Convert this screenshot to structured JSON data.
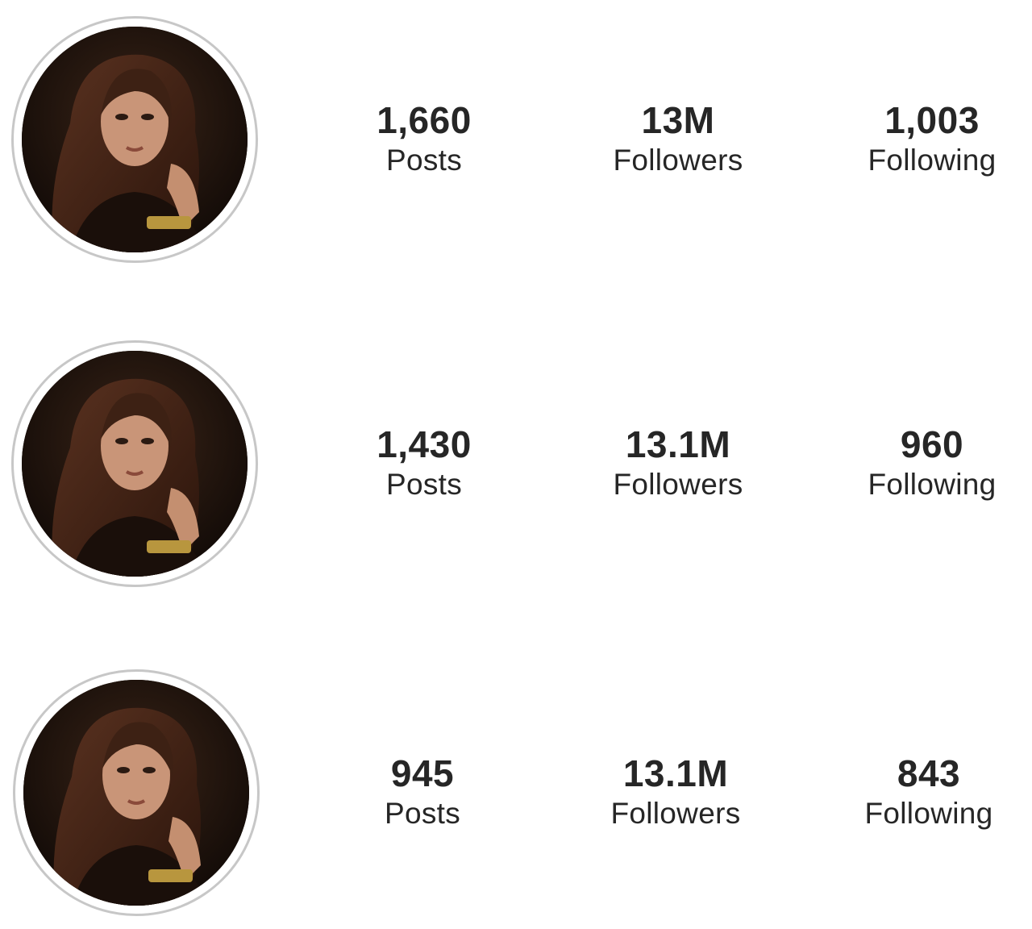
{
  "profiles": [
    {
      "posts": {
        "value": "1,660",
        "label": "Posts"
      },
      "followers": {
        "value": "13M",
        "label": "Followers"
      },
      "following": {
        "value": "1,003",
        "label": "Following"
      }
    },
    {
      "posts": {
        "value": "1,430",
        "label": "Posts"
      },
      "followers": {
        "value": "13.1M",
        "label": "Followers"
      },
      "following": {
        "value": "960",
        "label": "Following"
      }
    },
    {
      "posts": {
        "value": "945",
        "label": "Posts"
      },
      "followers": {
        "value": "13.1M",
        "label": "Followers"
      },
      "following": {
        "value": "843",
        "label": "Following"
      }
    }
  ],
  "colors": {
    "text": "#262626",
    "avatar_ring": "#c7c7c7",
    "background": "#ffffff"
  },
  "icons": {
    "avatar": "profile-photo"
  }
}
